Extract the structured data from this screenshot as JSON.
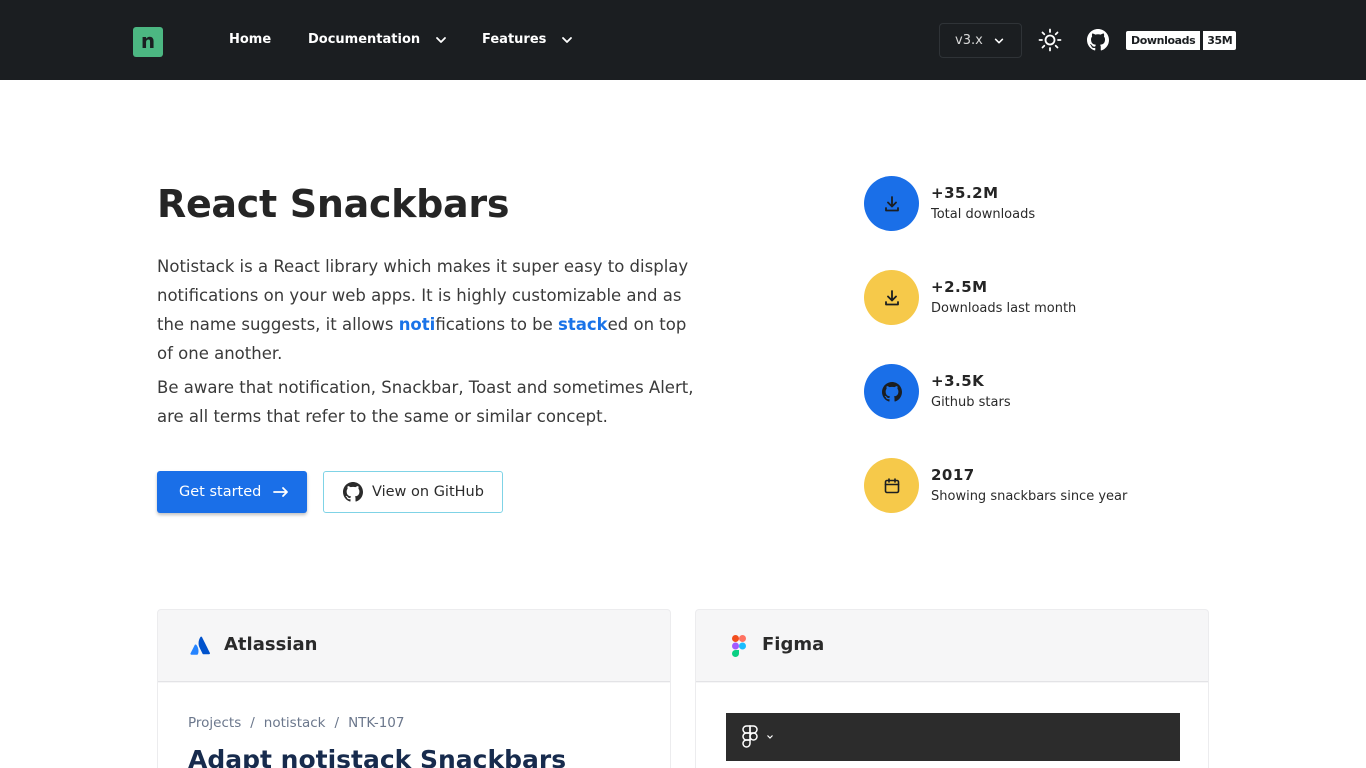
{
  "nav": {
    "logo_letter": "n",
    "home": "Home",
    "documentation": "Documentation",
    "features": "Features",
    "version": "v3.x",
    "downloads_label": "Downloads",
    "downloads_count": "35M"
  },
  "hero": {
    "title": "React Snackbars",
    "p1_a": "Notistack is a React library which makes it super easy to display notifications on your web apps. It is highly customizable and as the name suggests, it allows ",
    "p1_hl1": "noti",
    "p1_b": "fications to be ",
    "p1_hl2": "stack",
    "p1_c": "ed on top of one another.",
    "p2": "Be aware that notification, Snackbar, Toast and sometimes Alert, are all terms that refer to the same or similar concept.",
    "get_started": "Get started",
    "view_github": "View on GitHub"
  },
  "stats": [
    {
      "value": "+35.2M",
      "label": "Total downloads",
      "icon": "download-icon",
      "color": "#1a6fe8"
    },
    {
      "value": "+2.5M",
      "label": "Downloads last month",
      "icon": "download-icon",
      "color": "#f6c94a"
    },
    {
      "value": "+3.5K",
      "label": "Github stars",
      "icon": "github-icon",
      "color": "#1a6fe8"
    },
    {
      "value": "2017",
      "label": "Showing snackbars since year",
      "icon": "calendar-icon",
      "color": "#f6c94a"
    }
  ],
  "cards": {
    "atlassian": {
      "title": "Atlassian",
      "crumbs": [
        "Projects",
        "/",
        "notistack",
        "/",
        "NTK-107"
      ],
      "issue_title": "Adapt notistack Snackbars"
    },
    "figma": {
      "title": "Figma"
    }
  },
  "colors": {
    "nav_bg": "#1b1e21",
    "accent_blue": "#1a6fe8",
    "accent_yellow": "#f6c94a",
    "logo_green": "#4cb782"
  }
}
